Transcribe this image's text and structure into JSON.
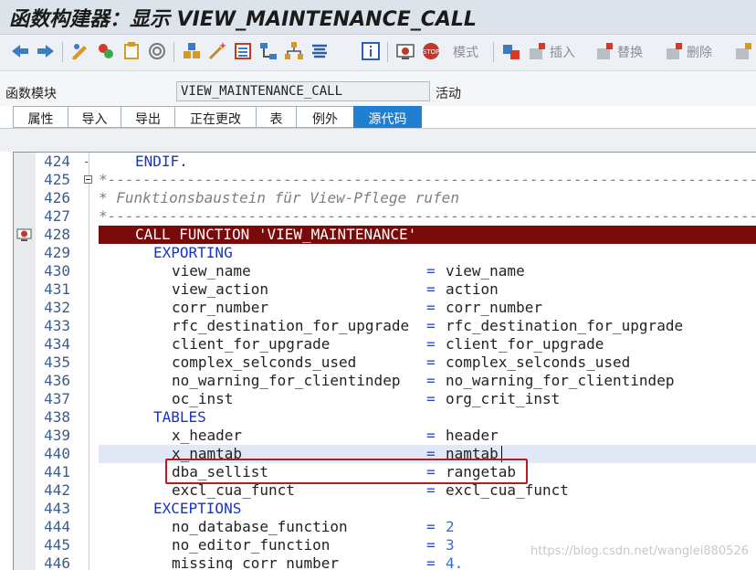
{
  "title": "函数构建器：显示 VIEW_MAINTENANCE_CALL",
  "toolbar": {
    "mode_label": "模式",
    "insert_label": "插入",
    "replace_label": "替换",
    "delete_label": "删除"
  },
  "header": {
    "field_label": "函数模块",
    "field_value": "VIEW_MAINTENANCE_CALL",
    "status": "活动"
  },
  "tabs": [
    {
      "label": "属性"
    },
    {
      "label": "导入"
    },
    {
      "label": "导出"
    },
    {
      "label": "正在更改"
    },
    {
      "label": "表"
    },
    {
      "label": "例外"
    },
    {
      "label": "源代码"
    }
  ],
  "lines": [
    {
      "no": "424",
      "code": "ENDIF."
    },
    {
      "no": "425",
      "code": "*--------------------------------------------------------------------------*"
    },
    {
      "no": "426",
      "code": "* Funktionsbaustein für View-Pflege rufen                                  *"
    },
    {
      "no": "427",
      "code": "*--------------------------------------------------------------------------*"
    },
    {
      "no": "428",
      "code": "CALL FUNCTION 'VIEW_MAINTENANCE'"
    },
    {
      "no": "429",
      "code": "EXPORTING"
    },
    {
      "no": "430",
      "param": "view_name",
      "value": "view_name"
    },
    {
      "no": "431",
      "param": "view_action",
      "value": "action"
    },
    {
      "no": "432",
      "param": "corr_number",
      "value": "corr_number"
    },
    {
      "no": "433",
      "param": "rfc_destination_for_upgrade",
      "value": "rfc_destination_for_upgrade"
    },
    {
      "no": "434",
      "param": "client_for_upgrade",
      "value": "client_for_upgrade"
    },
    {
      "no": "435",
      "param": "complex_selconds_used",
      "value": "complex_selconds_used"
    },
    {
      "no": "436",
      "param": "no_warning_for_clientindep",
      "value": "no_warning_for_clientindep"
    },
    {
      "no": "437",
      "param": "oc_inst",
      "value": "org_crit_inst"
    },
    {
      "no": "438",
      "code": "TABLES"
    },
    {
      "no": "439",
      "param": "x_header",
      "value": "header"
    },
    {
      "no": "440",
      "param": "x_namtab",
      "value": "namtab"
    },
    {
      "no": "441",
      "param": "dba_sellist",
      "value": "rangetab"
    },
    {
      "no": "442",
      "param": "excl_cua_funct",
      "value": "excl_cua_funct"
    },
    {
      "no": "443",
      "code": "EXCEPTIONS"
    },
    {
      "no": "444",
      "param": "no_database_function",
      "value": "2"
    },
    {
      "no": "445",
      "param": "no_editor_function",
      "value": "3"
    },
    {
      "no": "446",
      "param": "missing_corr_number",
      "value": "4."
    }
  ],
  "eq": "=",
  "watermark": "https://blog.csdn.net/wanglei880526",
  "colors": {
    "highlight_line": "#7a0a0a",
    "keyword": "#1436c4",
    "active_tab": "#1f7fd1",
    "annotation_box": "#b01e1e"
  }
}
